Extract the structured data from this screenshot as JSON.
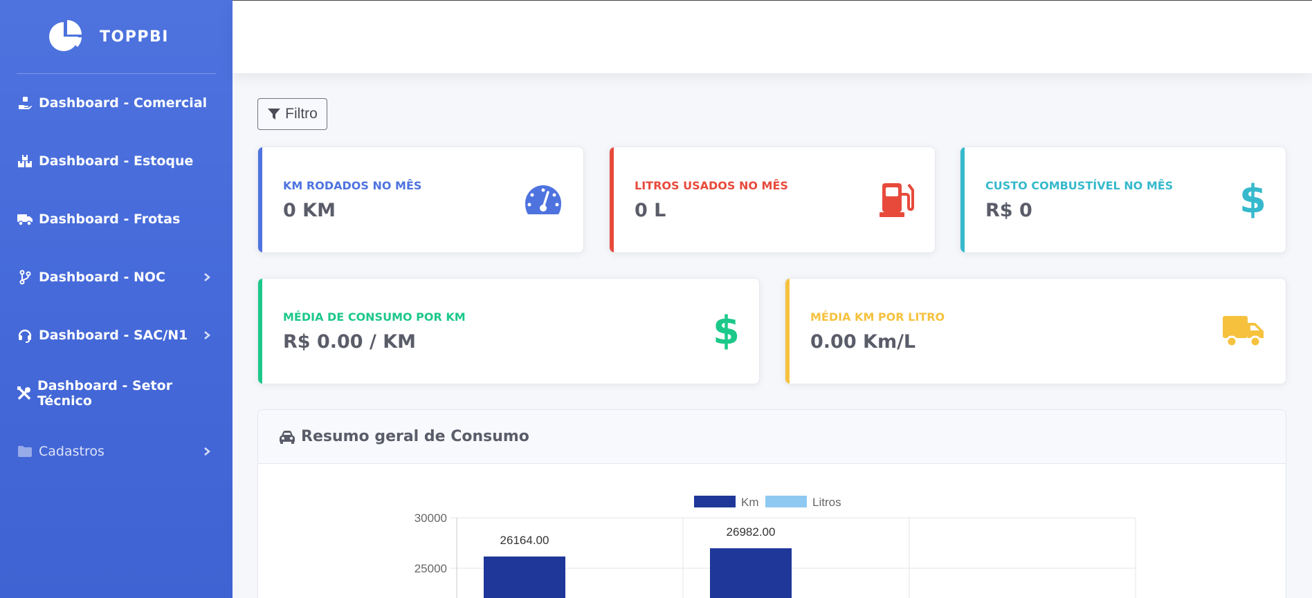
{
  "brand": {
    "name": "TOPPBI"
  },
  "sidebar": {
    "items": [
      {
        "label": "Dashboard - Comercial",
        "icon": "hand-holding-icon"
      },
      {
        "label": "Dashboard - Estoque",
        "icon": "boxes-icon"
      },
      {
        "label": "Dashboard - Frotas",
        "icon": "truck-icon"
      },
      {
        "label": "Dashboard - NOC",
        "icon": "code-branch-icon"
      },
      {
        "label": "Dashboard - SAC/N1",
        "icon": "headset-icon"
      },
      {
        "label": "Dashboard - Setor Técnico",
        "icon": "tools-icon"
      },
      {
        "label": "Cadastros",
        "icon": "folder-icon"
      }
    ]
  },
  "filter": {
    "label": "Filtro"
  },
  "cards": [
    {
      "title": "KM RODADOS NO MÊS",
      "value": "0 KM",
      "color": "#4e73df",
      "icon": "tachometer-icon"
    },
    {
      "title": "LITROS USADOS NO MÊS",
      "value": "0 L",
      "color": "#e74a3b",
      "icon": "gas-pump-icon"
    },
    {
      "title": "CUSTO COMBUSTÍVEL NO MÊS",
      "value": "R$ 0",
      "color": "#36b9cc",
      "icon": "dollar-icon"
    },
    {
      "title": "MÉDIA DE CONSUMO POR KM",
      "value": "R$ 0.00 / KM",
      "color": "#1cc88a",
      "icon": "dollar-icon"
    },
    {
      "title": "MÉDIA KM POR LITRO",
      "value": "0.00 Km/L",
      "color": "#f6c23e",
      "icon": "truck-icon"
    }
  ],
  "panel": {
    "title": "Resumo geral de Consumo",
    "icon": "car-icon"
  },
  "chart_data": {
    "type": "bar",
    "series": [
      {
        "name": "Km",
        "color": "#1e3799",
        "values": [
          26164.0,
          26982.0
        ]
      },
      {
        "name": "Litros",
        "color": "#8ec9f2",
        "values": []
      }
    ],
    "data_labels": [
      "26164.00",
      "26982.00"
    ],
    "y_ticks": [
      "30000",
      "25000"
    ],
    "ylim_visible": [
      25000,
      30000
    ],
    "grid": true,
    "legend": "top-center"
  }
}
